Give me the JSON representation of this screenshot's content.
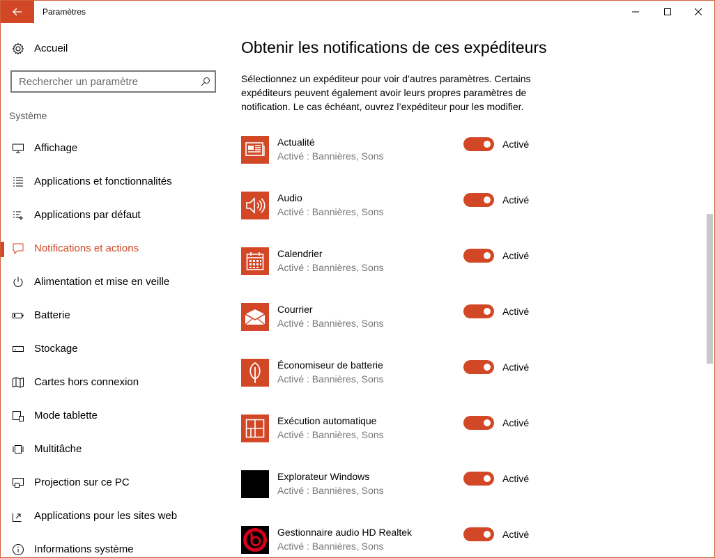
{
  "window": {
    "title": "Paramètres",
    "accent": "#d24726"
  },
  "sidebar": {
    "home_label": "Accueil",
    "search_placeholder": "Rechercher un paramètre",
    "section_label": "Système",
    "items": [
      {
        "label": "Affichage",
        "icon": "monitor-icon"
      },
      {
        "label": "Applications et fonctionnalités",
        "icon": "app-list-icon"
      },
      {
        "label": "Applications par défaut",
        "icon": "default-apps-icon"
      },
      {
        "label": "Notifications et actions",
        "icon": "notification-icon",
        "active": true
      },
      {
        "label": "Alimentation et mise en veille",
        "icon": "power-icon"
      },
      {
        "label": "Batterie",
        "icon": "battery-icon"
      },
      {
        "label": "Stockage",
        "icon": "storage-icon"
      },
      {
        "label": "Cartes hors connexion",
        "icon": "map-icon"
      },
      {
        "label": "Mode tablette",
        "icon": "tablet-icon"
      },
      {
        "label": "Multitâche",
        "icon": "multitask-icon"
      },
      {
        "label": "Projection sur ce PC",
        "icon": "projection-icon"
      },
      {
        "label": "Applications pour les sites web",
        "icon": "web-apps-icon"
      },
      {
        "label": "Informations système",
        "icon": "info-icon"
      }
    ]
  },
  "main": {
    "title": "Obtenir les notifications de ces expéditeurs",
    "description": "Sélectionnez un expéditeur pour voir d’autres paramètres. Certains expéditeurs peuvent également avoir leurs propres paramètres de notification. Le cas échéant, ouvrez l’expéditeur pour les modifier.",
    "senders": [
      {
        "name": "Actualité",
        "status": "Activé : Bannières, Sons",
        "toggle": "Activé",
        "icon": "news-icon"
      },
      {
        "name": "Audio",
        "status": "Activé : Bannières, Sons",
        "toggle": "Activé",
        "icon": "speaker-icon"
      },
      {
        "name": "Calendrier",
        "status": "Activé : Bannières, Sons",
        "toggle": "Activé",
        "icon": "calendar-icon"
      },
      {
        "name": "Courrier",
        "status": "Activé : Bannières, Sons",
        "toggle": "Activé",
        "icon": "mail-icon"
      },
      {
        "name": "Économiseur de batterie",
        "status": "Activé : Bannières, Sons",
        "toggle": "Activé",
        "icon": "battery-saver-icon"
      },
      {
        "name": "Exécution automatique",
        "status": "Activé : Bannières, Sons",
        "toggle": "Activé",
        "icon": "autoplay-icon"
      },
      {
        "name": "Explorateur Windows",
        "status": "Activé : Bannières, Sons",
        "toggle": "Activé",
        "icon": "explorer-icon"
      },
      {
        "name": "Gestionnaire audio HD Realtek",
        "status": "Activé : Bannières, Sons",
        "toggle": "Activé",
        "icon": "beats-icon"
      }
    ]
  }
}
